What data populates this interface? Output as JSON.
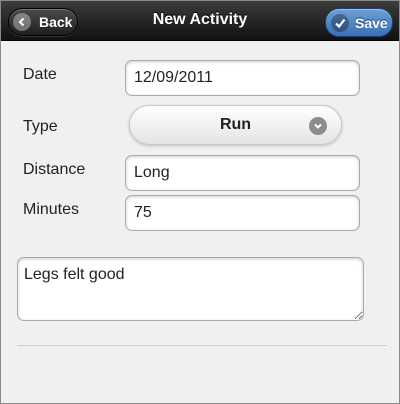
{
  "header": {
    "title": "New Activity",
    "back_label": "Back",
    "save_label": "Save"
  },
  "form": {
    "date": {
      "label": "Date",
      "value": "12/09/2011"
    },
    "type": {
      "label": "Type",
      "value": "Run"
    },
    "distance": {
      "label": "Distance",
      "value": "Long"
    },
    "minutes": {
      "label": "Minutes",
      "value": "75"
    },
    "notes": {
      "value": "Legs felt good"
    }
  },
  "icons": {
    "back": "arrow-left-icon",
    "save": "checkmark-icon",
    "select": "chevron-down-icon"
  },
  "colors": {
    "header_dark": "#111111",
    "save_accent": "#3b6fb3",
    "background": "#f0f0f0"
  }
}
